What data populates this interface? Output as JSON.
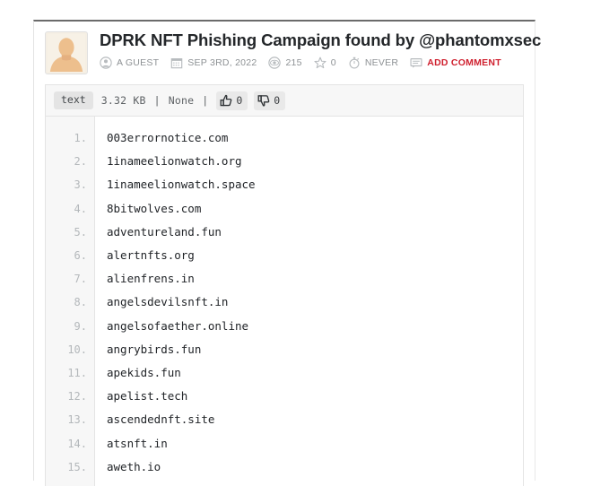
{
  "paste": {
    "title": "DPRK NFT Phishing Campaign found by @phantomxsec",
    "avatar_icon": "default-user-avatar",
    "meta": [
      {
        "key": "author",
        "icon": "user-icon",
        "label": "A GUEST"
      },
      {
        "key": "date",
        "icon": "calendar-icon",
        "label": "SEP 3RD, 2022"
      },
      {
        "key": "views",
        "icon": "eye-icon",
        "label": "215"
      },
      {
        "key": "rating",
        "icon": "star-icon",
        "label": "0"
      },
      {
        "key": "expires",
        "icon": "stopwatch-icon",
        "label": "NEVER"
      },
      {
        "key": "comment",
        "icon": "comment-icon",
        "label": "ADD COMMENT"
      }
    ],
    "toolbar": {
      "syntax_label": "text",
      "size_label": "3.32 KB",
      "separator": "|",
      "expire_label": "None",
      "thumbs_up_icon": "thumbs-up-icon",
      "thumbs_up_count": "0",
      "thumbs_down_icon": "thumbs-down-icon",
      "thumbs_down_count": "0"
    },
    "line_numbers": [
      "1.",
      "2.",
      "3.",
      "4.",
      "5.",
      "6.",
      "7.",
      "8.",
      "9.",
      "10.",
      "11.",
      "12.",
      "13.",
      "14.",
      "15."
    ],
    "lines": [
      "003errornotice.com",
      "1inameelionwatch.org",
      "1inameelionwatch.space",
      "8bitwolves.com",
      "adventureland.fun",
      "alertnfts.org",
      "alienfrens.in",
      "angelsdevilsnft.in",
      "angelsofaether.online",
      "angrybirds.fun",
      "apekids.fun",
      "apelist.tech",
      "ascendednft.site",
      "atsnft.in",
      "aweth.io"
    ]
  },
  "colors": {
    "accent_red": "#cf1f2e",
    "meta_gray": "#8d9194",
    "title_dark": "#24272a",
    "code_dark": "#212428",
    "gutter_gray": "#b4b8bb",
    "panel_border": "#e4e4e4"
  }
}
